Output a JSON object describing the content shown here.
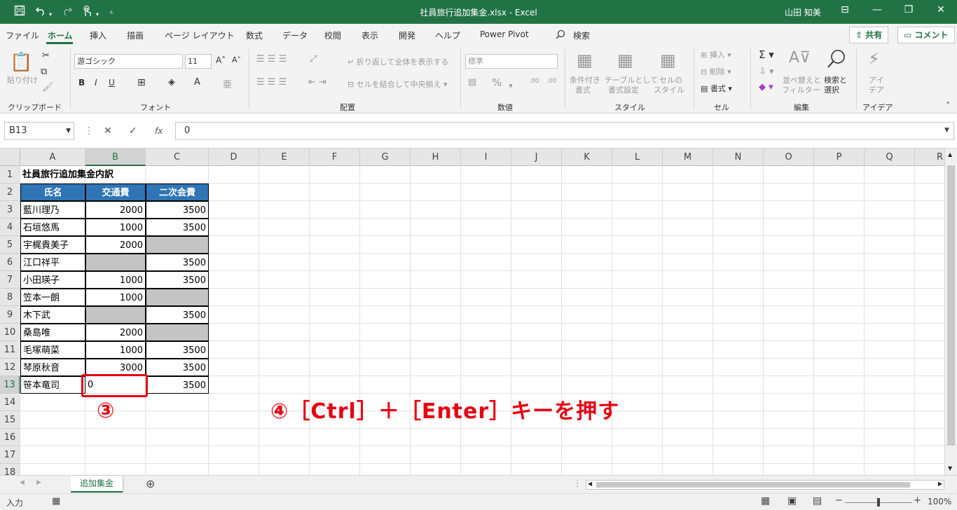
{
  "window": {
    "title": "社員旅行追加集金.xlsx  -  Excel",
    "user": "山田 知美",
    "qa_icons": [
      "save-icon",
      "undo-icon",
      "redo-icon",
      "touch-mode-icon",
      "customize-icon"
    ]
  },
  "menu": {
    "tabs": [
      "ファイル",
      "ホーム",
      "挿入",
      "描画",
      "ページ レイアウト",
      "数式",
      "データ",
      "校閲",
      "表示",
      "開発",
      "ヘルプ",
      "Power Pivot",
      "検索"
    ],
    "share": "共有",
    "comment": "コメント"
  },
  "ribbon": {
    "clipboard": {
      "paste": "貼り付け",
      "group": "クリップボード"
    },
    "font": {
      "name": "游ゴシック",
      "size": "11",
      "group": "フォント"
    },
    "align": {
      "wrap": "折り返して全体を表示する",
      "merge": "セルを結合して中央揃え",
      "group": "配置"
    },
    "number": {
      "format": "標準",
      "group": "数値"
    },
    "style": {
      "cond1": "条件付き",
      "cond2": "書式",
      "table1": "テーブルとして",
      "table2": "書式設定",
      "cell1": "セルの",
      "cell2": "スタイル",
      "group": "スタイル"
    },
    "cells": {
      "insert": "挿入",
      "delete": "削除",
      "format": "書式",
      "group": "セル"
    },
    "edit": {
      "sort1": "並べ替えと",
      "sort2": "フィルター",
      "find1": "検索と",
      "find2": "選択",
      "group": "編集"
    },
    "ideas": {
      "l1": "アイ",
      "l2": "デア",
      "group": "アイデア"
    }
  },
  "formula": {
    "namebox": "B13",
    "fx": "fx",
    "value": "0"
  },
  "columns": [
    "A",
    "B",
    "C",
    "D",
    "E",
    "F",
    "G",
    "H",
    "I",
    "J",
    "K",
    "L",
    "M",
    "N",
    "O",
    "P",
    "Q",
    "R"
  ],
  "rows": [
    "1",
    "2",
    "3",
    "4",
    "5",
    "6",
    "7",
    "8",
    "9",
    "10",
    "11",
    "12",
    "13",
    "14",
    "15",
    "16",
    "17",
    "18"
  ],
  "sheet": {
    "title": "社員旅行追加集金内訳",
    "headers": [
      "氏名",
      "交通費",
      "二次会費"
    ],
    "data": [
      {
        "name": "藍川理乃",
        "b": "2000",
        "c": "3500"
      },
      {
        "name": "石垣悠馬",
        "b": "1000",
        "c": "3500"
      },
      {
        "name": "宇梶貴美子",
        "b": "2000",
        "c": ""
      },
      {
        "name": "江口祥平",
        "b": "",
        "c": "3500"
      },
      {
        "name": "小田瑛子",
        "b": "1000",
        "c": "3500"
      },
      {
        "name": "笠本一朗",
        "b": "1000",
        "c": ""
      },
      {
        "name": "木下武",
        "b": "",
        "c": "3500"
      },
      {
        "name": "桑島唯",
        "b": "2000",
        "c": ""
      },
      {
        "name": "毛塚萌菜",
        "b": "1000",
        "c": "3500"
      },
      {
        "name": "琴原秋音",
        "b": "3000",
        "c": "3500"
      },
      {
        "name": "笹本竜司",
        "b": "0",
        "c": "3500"
      }
    ]
  },
  "annotations": {
    "step3": "③",
    "step4": "④［Ctrl］＋［Enter］キーを押す"
  },
  "sheet_tab": "追加集金",
  "status": {
    "mode": "入力",
    "zoom": "100%"
  },
  "colors": {
    "excel_green": "#217346",
    "header_blue": "#2f75b5",
    "annotation_red": "#e60012"
  }
}
